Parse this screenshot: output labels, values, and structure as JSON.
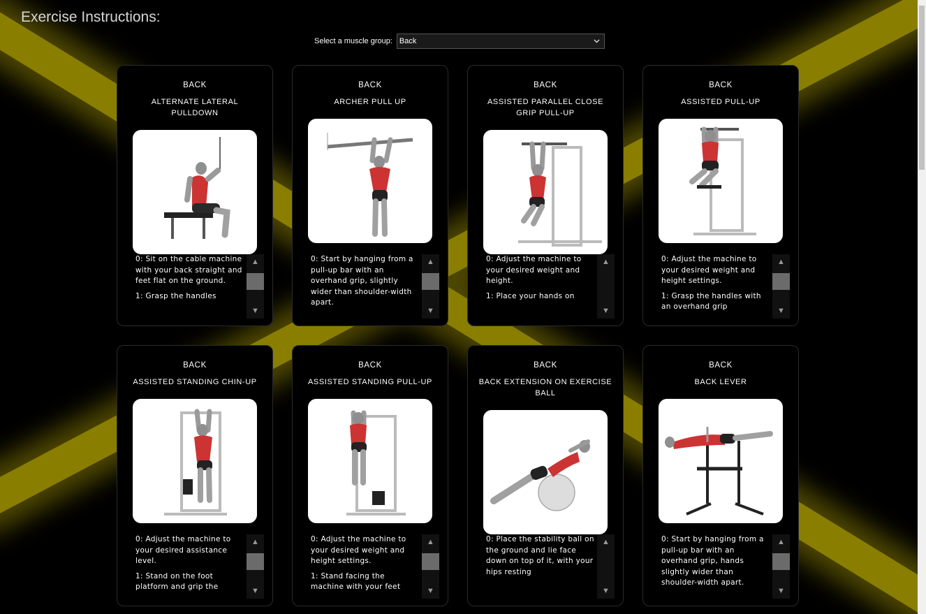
{
  "page": {
    "heading": "Exercise Instructions:",
    "accent_color": "#8e8200"
  },
  "selector": {
    "label": "Select a muscle group:",
    "value": "Back",
    "icon": "chevron-down-icon"
  },
  "cards": [
    {
      "group": "BACK",
      "title": "ALTERNATE LATERAL PULLDOWN",
      "instructions": [
        "0: Sit on the cable machine with your back straight and feet flat on the ground.",
        "1: Grasp the handles"
      ]
    },
    {
      "group": "BACK",
      "title": "ARCHER PULL UP",
      "instructions": [
        "0: Start by hanging from a pull-up bar with an overhand grip, slightly wider than shoulder-width apart."
      ]
    },
    {
      "group": "BACK",
      "title": "ASSISTED PARALLEL CLOSE GRIP PULL-UP",
      "instructions": [
        "0: Adjust the machine to your desired weight and height.",
        "1: Place your hands on"
      ]
    },
    {
      "group": "BACK",
      "title": "ASSISTED PULL-UP",
      "instructions": [
        "0: Adjust the machine to your desired weight and height settings.",
        "1: Grasp the handles with an overhand grip"
      ]
    },
    {
      "group": "BACK",
      "title": "ASSISTED STANDING CHIN-UP",
      "instructions": [
        "0: Adjust the machine to your desired assistance level.",
        "1: Stand on the foot platform and grip the"
      ]
    },
    {
      "group": "BACK",
      "title": "ASSISTED STANDING PULL-UP",
      "instructions": [
        "0: Adjust the machine to your desired weight and height settings.",
        "1: Stand facing the machine with your feet"
      ]
    },
    {
      "group": "BACK",
      "title": "BACK EXTENSION ON EXERCISE BALL",
      "instructions": [
        "0: Place the stability ball on the ground and lie face down on top of it, with your hips resting"
      ]
    },
    {
      "group": "BACK",
      "title": "BACK LEVER",
      "instructions": [
        "0: Start by hanging from a pull-up bar with an overhand grip, hands slightly wider than shoulder-width apart."
      ]
    }
  ]
}
